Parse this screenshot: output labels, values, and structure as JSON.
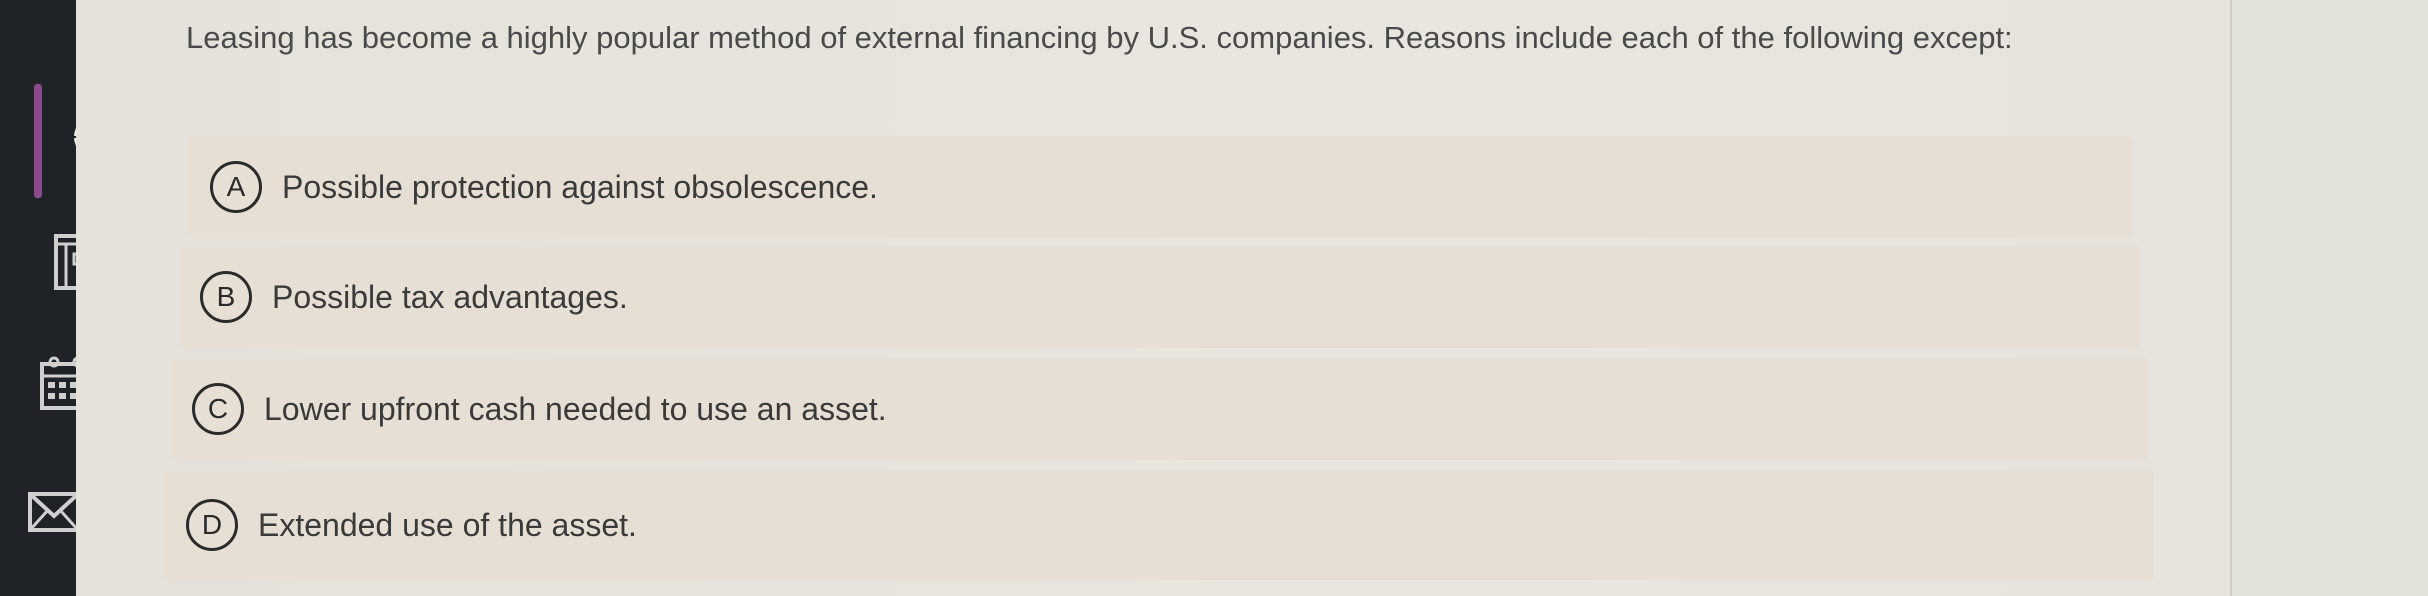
{
  "sidebar": {
    "icons": [
      "user-icon",
      "globe-icon",
      "document-icon",
      "calendar-icon",
      "mail-icon"
    ]
  },
  "question": {
    "text": "Leasing has become a highly popular method of external financing by U.S. companies. Reasons include each of the following except:"
  },
  "options": [
    {
      "letter": "A",
      "text": "Possible protection against obsolescence."
    },
    {
      "letter": "B",
      "text": "Possible tax advantages."
    },
    {
      "letter": "C",
      "text": "Lower upfront cash needed to use an asset."
    },
    {
      "letter": "D",
      "text": "Extended use of the asset."
    }
  ],
  "colors": {
    "sidebar": "#1f2226",
    "active_indicator": "#8a4a8c",
    "option_bg": "#e7dfd4",
    "page_bg": "#e6e4dc"
  }
}
